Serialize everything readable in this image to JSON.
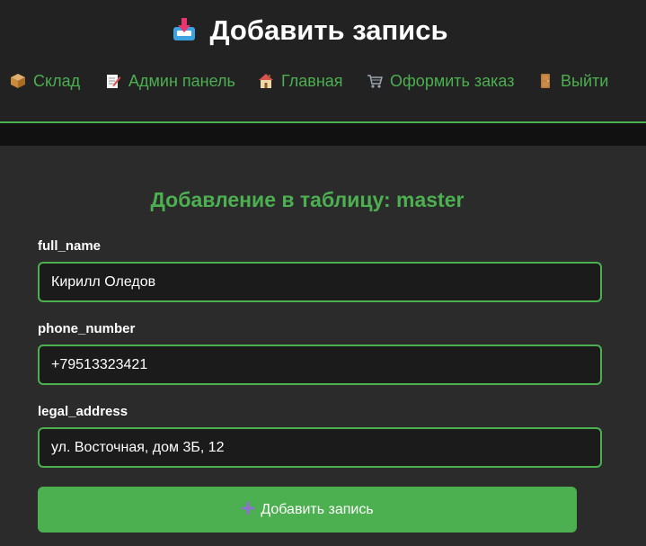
{
  "header": {
    "title": "Добавить запись",
    "title_icon": "inbox-tray-icon"
  },
  "nav": {
    "items": [
      {
        "label": "Склад",
        "icon": "package-icon"
      },
      {
        "label": "Админ панель",
        "icon": "memo-icon"
      },
      {
        "label": "Главная",
        "icon": "house-icon"
      },
      {
        "label": "Оформить заказ",
        "icon": "shopping-cart-icon"
      },
      {
        "label": "Выйти",
        "icon": "door-icon"
      }
    ]
  },
  "form": {
    "title": "Добавление в таблицу: master",
    "fields": [
      {
        "label": "full_name",
        "value": "Кирилл Оледов"
      },
      {
        "label": "phone_number",
        "value": "+79513323421"
      },
      {
        "label": "legal_address",
        "value": "ул. Восточная, дом 3Б, 12"
      }
    ],
    "submit_label": "Добавить запись",
    "submit_icon": "plus-icon"
  },
  "colors": {
    "accent": "#4caf50",
    "background": "#2b2b2b",
    "header_background": "#222222"
  }
}
